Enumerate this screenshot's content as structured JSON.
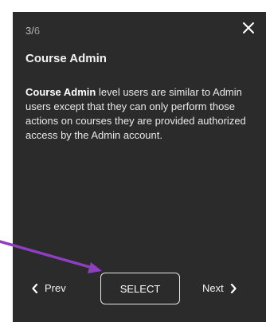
{
  "tour": {
    "step_current": "3/",
    "step_total": "6",
    "title": "Course Admin",
    "body_bold": "Course Admin",
    "body_rest": " level users are similar to Admin users except that they can only perform those actions on courses they are provided authorized access by the Admin account.",
    "prev_label": "Prev",
    "select_label": "SELECT",
    "next_label": "Next"
  },
  "icons": {
    "close": "close-icon",
    "prev": "chevron-left-icon",
    "next": "chevron-right-icon",
    "pointer": "arrow-annotation"
  },
  "colors": {
    "card_background": "#2b2b2b",
    "text": "#ffffff",
    "arrow": "#8e3fc0"
  }
}
